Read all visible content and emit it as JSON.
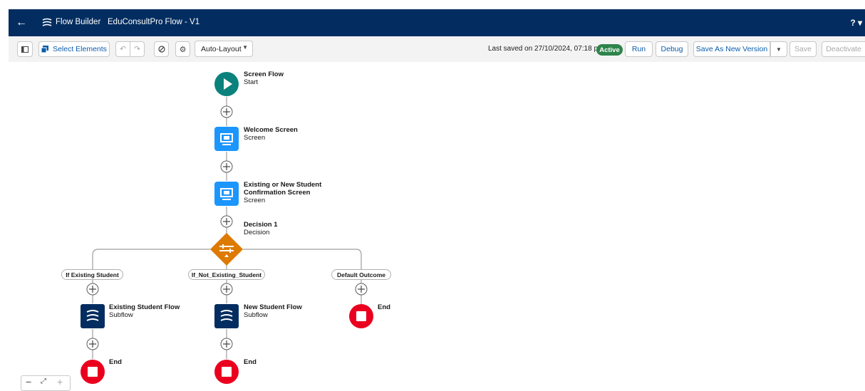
{
  "header": {
    "back_icon": "arrow-left-icon",
    "app_name": "Flow Builder",
    "flow_title": "EduConsultPro Flow - V1",
    "help": "? ▾"
  },
  "toolbar": {
    "select_elements": "Select Elements",
    "layout_select": "Auto-Layout",
    "last_saved": "Last saved on 27/10/2024, 07:18 pm",
    "status": "Active",
    "run": "Run",
    "debug": "Debug",
    "save_as_new_version": "Save As New Version",
    "save": "Save",
    "deactivate": "Deactivate"
  },
  "flow": {
    "start": {
      "title": "Screen Flow",
      "subtitle": "Start"
    },
    "welcome": {
      "title": "Welcome Screen",
      "subtitle": "Screen"
    },
    "confirm": {
      "title1": "Existing or New Student",
      "title2": "Confirmation Screen",
      "subtitle": "Screen"
    },
    "decision": {
      "title": "Decision 1",
      "subtitle": "Decision"
    },
    "outcomes": [
      "If Existing Student",
      "If_Not_Existing_Student",
      "Default Outcome"
    ],
    "existing_flow": {
      "title": "Existing Student Flow",
      "subtitle": "Subflow"
    },
    "new_flow": {
      "title": "New Student Flow",
      "subtitle": "Subflow"
    },
    "end_label": "End"
  },
  "colors": {
    "header": "#032d60",
    "start": "#0b827c",
    "screen": "#1b96ff",
    "decision": "#dd7a01",
    "subflow": "#032d60",
    "end": "#ea001e",
    "active": "#2e844a"
  }
}
